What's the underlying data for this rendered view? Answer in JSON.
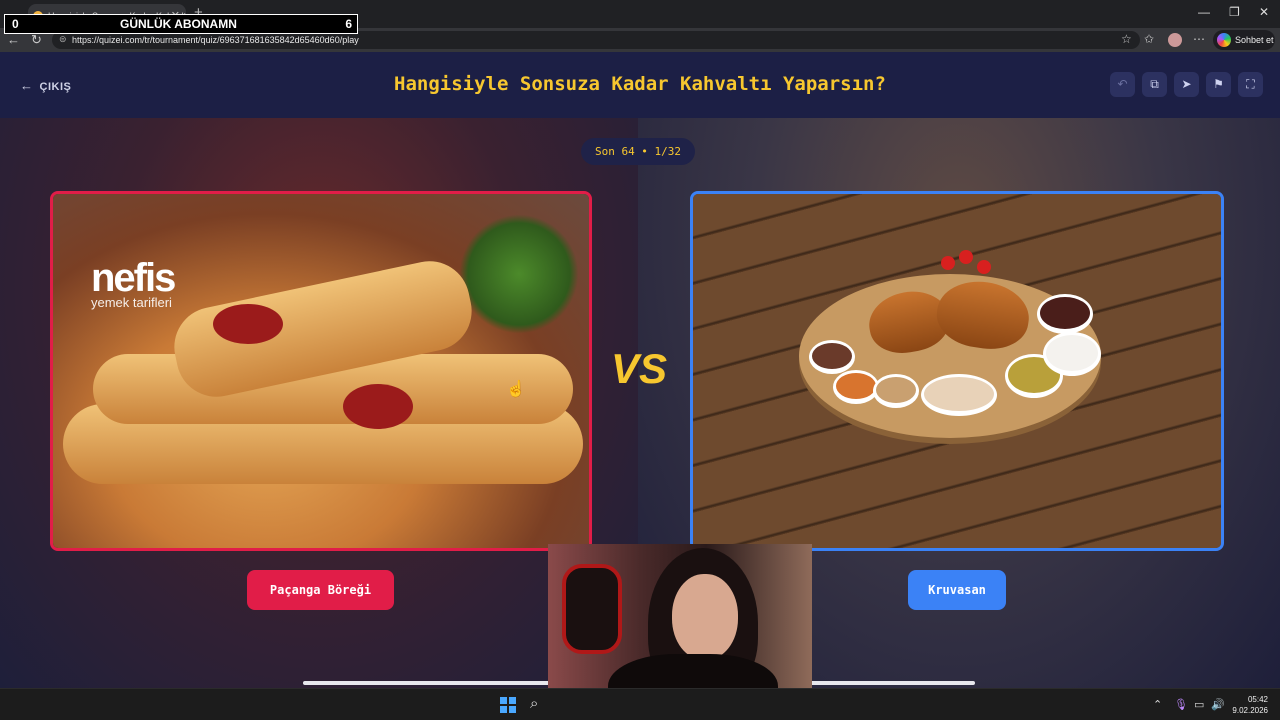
{
  "browser": {
    "tab_title": "Hangisiyle Sonsuza Kadar Kahvalt",
    "tab_close": "✕",
    "new_tab": "+",
    "url": "https://quizei.com/tr/tournament/quiz/696371681635842d65460d60/play",
    "chat_label": "Sohbet et"
  },
  "stream_overlay": {
    "left_count": "0",
    "label": "GÜNLÜK ABONAMN",
    "right_count": "6"
  },
  "header": {
    "exit_label": "ÇIKIŞ",
    "title": "Hangisiyle Sonsuza Kadar Kahvaltı Yaparsın?",
    "buttons": [
      "undo-icon",
      "share-icon",
      "send-icon",
      "flag-icon",
      "fullscreen-icon"
    ]
  },
  "round": {
    "label": "Son 64 • 1/32"
  },
  "left_choice": {
    "image_logo": "nefis",
    "image_logo_sub": "yemek tarifleri",
    "label": "Paçanga Böreği",
    "accent": "#e11d48"
  },
  "right_choice": {
    "label": "Kruvasan",
    "accent": "#3b82f6"
  },
  "versus": "VS",
  "colors": {
    "title": "#f7c72f",
    "header_bg": "#1c1f45"
  },
  "taskbar": {
    "time": "05:42",
    "date": "9.02.2026"
  }
}
